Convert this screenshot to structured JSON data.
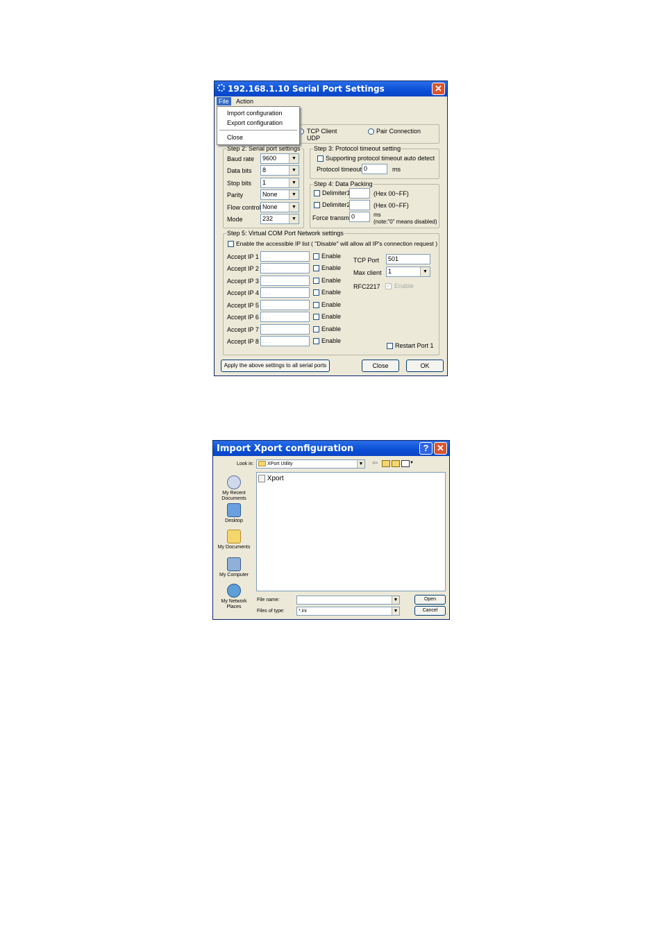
{
  "serial_window": {
    "title": "192.168.1.10 Serial Port Settings",
    "menu": {
      "file": "File",
      "action": "Action"
    },
    "file_menu": {
      "import": "Import configuration",
      "export": "Export configuration",
      "close": "Close"
    },
    "mode": {
      "tcp_client": "TCP Client",
      "udp": "UDP",
      "pair_connection": "Pair Connection"
    },
    "step2": {
      "legend": "Step 2: Serial port settings",
      "baud_rate": {
        "label": "Baud rate",
        "value": "9600"
      },
      "data_bits": {
        "label": "Data bits",
        "value": "8"
      },
      "stop_bits": {
        "label": "Stop bits",
        "value": "1"
      },
      "parity": {
        "label": "Parity",
        "value": "None"
      },
      "flow_control": {
        "label": "Flow control",
        "value": "None"
      },
      "mode": {
        "label": "Mode",
        "value": "232"
      }
    },
    "step3": {
      "legend": "Step 3: Protocol timeout setting",
      "auto_detect": "Supporting protocol timeout auto detect",
      "timeout_label": "Protocol timeout",
      "timeout_value": "0",
      "timeout_unit": "ms"
    },
    "step4": {
      "legend": "Step 4: Data Packing",
      "delimiter1": "Delimiter1",
      "delimiter2": "Delimiter2",
      "hex_hint": "(Hex 00~FF)",
      "force_transmit": "Force transmit",
      "force_value": "0",
      "force_unit": "ms",
      "force_note": "(note:\"0\" means disabled)"
    },
    "step5": {
      "legend": "Step 5: Virtual COM Port Network settings",
      "ip_list_check": "Enable the accessible IP list ( \"Disable\" will allow all IP's connection request )",
      "ip_placeholder": ". . .",
      "enable_label": "Enable",
      "accept_ips": [
        "Accept IP 1",
        "Accept IP 2",
        "Accept IP 3",
        "Accept IP 4",
        "Accept IP 5",
        "Accept IP 6",
        "Accept IP 7",
        "Accept IP 8"
      ],
      "tcp_port_label": "TCP Port",
      "tcp_port_value": "501",
      "max_client_label": "Max client",
      "max_client_value": "1",
      "rfc2217_label": "RFC2217",
      "rfc2217_enable": "Enable",
      "restart_port": "Restart Port 1"
    },
    "buttons": {
      "apply_all": "Apply the above settings to all serial ports",
      "close": "Close",
      "ok": "OK"
    }
  },
  "import_window": {
    "title": "Import Xport configuration",
    "look_in_label": "Look in:",
    "look_in_value": "XPort Utility",
    "places": [
      "My Recent Documents",
      "Desktop",
      "My Documents",
      "My Computer",
      "My Network Places"
    ],
    "files": [
      "Xport"
    ],
    "file_name_label": "File name:",
    "file_name_value": "",
    "files_of_type_label": "Files of type:",
    "files_of_type_value": "*.ini",
    "open": "Open",
    "cancel": "Cancel"
  }
}
